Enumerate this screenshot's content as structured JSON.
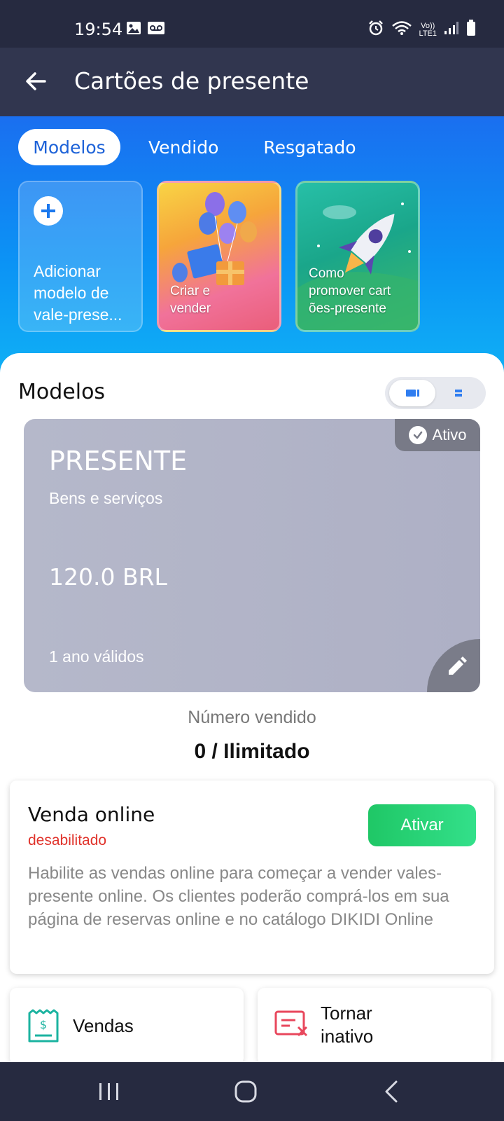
{
  "status_bar": {
    "time": "19:54",
    "network_label_top": "Vo))",
    "network_label_bottom": "LTE1",
    "icons": [
      "image-icon",
      "voicemail-icon",
      "alarm-icon",
      "wifi-icon",
      "signal-icon",
      "battery-icon"
    ]
  },
  "app_bar": {
    "title": "Cartões de presente",
    "back_icon": "arrow-left-icon"
  },
  "tabs": [
    {
      "label": "Modelos",
      "active": true
    },
    {
      "label": "Vendido",
      "active": false
    },
    {
      "label": "Resgatado",
      "active": false
    }
  ],
  "tiles": {
    "add": {
      "label": "Adicionar modelo de vale-prese..."
    },
    "create": {
      "label_line1": "Criar e",
      "label_line2": "vender"
    },
    "promote": {
      "label_line1": "Como",
      "label_line2": "promover cart",
      "label_line3": "ões-presente"
    }
  },
  "section": {
    "title": "Modelos"
  },
  "gift_card": {
    "status": "Ativo",
    "title": "PRESENTE",
    "subtitle": "Bens e serviços",
    "price": "120.0 BRL",
    "validity": "1 ano válidos"
  },
  "sold": {
    "label": "Número vendido",
    "value": "0 / Ilimitado"
  },
  "online_sale": {
    "title": "Venda online",
    "status": "desabilitado",
    "button": "Ativar",
    "description": "Habilite as vendas online para começar a vender vales-presente online. Os clientes poderão comprá-los em sua página de reservas online e no catálogo DIKIDI Online"
  },
  "actions": {
    "sales_label": "Vendas",
    "inactive_line1": "Tornar",
    "inactive_line2": "inativo"
  },
  "colors": {
    "status_bar": "#262a40",
    "app_bar": "#31364f",
    "hero_top": "#1a6ff0",
    "hero_bottom": "#10b2f5",
    "accent_green": "#1fc766",
    "disabled_red": "#e0322a",
    "card_gray": "#b5b8ca"
  }
}
